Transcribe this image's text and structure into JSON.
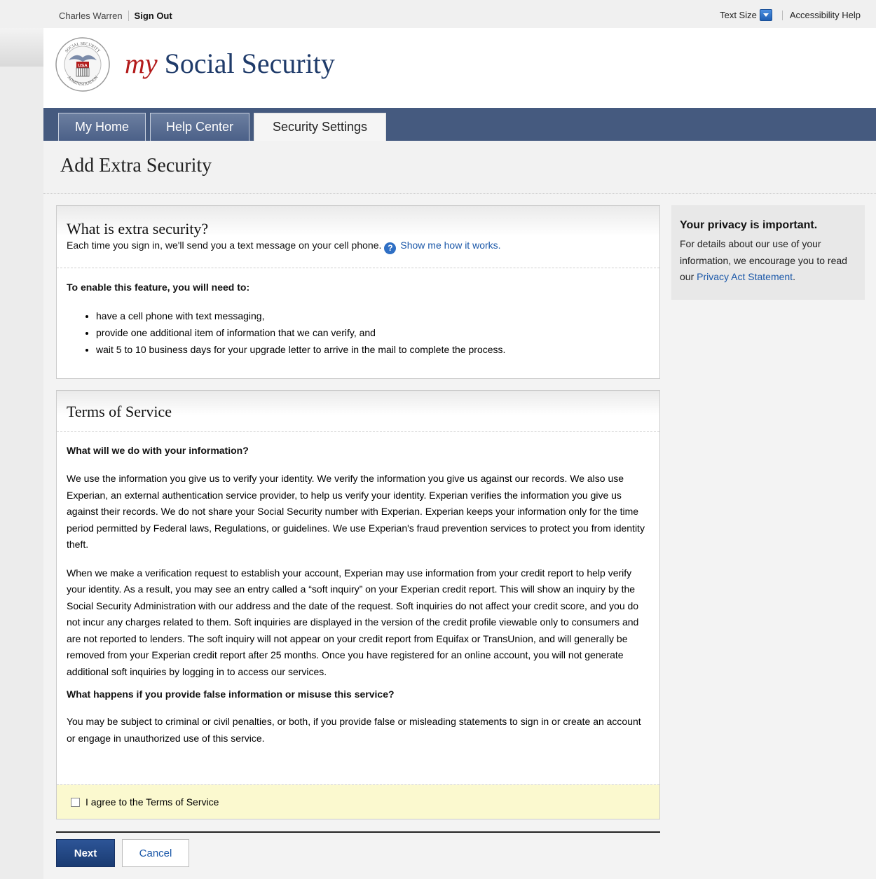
{
  "utility": {
    "user_name": "Charles Warren",
    "sign_out": "Sign Out",
    "text_size": "Text Size",
    "accessibility_help": "Accessibility Help"
  },
  "header": {
    "brand_my": "my",
    "brand_rest": "Social Security",
    "seal_text_top": "SOCIAL SECURITY",
    "seal_text_bottom": "ADMINISTRATION",
    "seal_center": "USA"
  },
  "nav": {
    "tabs": [
      {
        "label": "My Home",
        "active": false
      },
      {
        "label": "Help Center",
        "active": false
      },
      {
        "label": "Security Settings",
        "active": true
      }
    ]
  },
  "page": {
    "title": "Add Extra Security"
  },
  "extra": {
    "heading": "What is extra security?",
    "intro": "Each time you sign in, we'll send you a text message on your cell phone.",
    "help_icon": "?",
    "show_link": "Show me how it works.",
    "enable_heading": "To enable this feature, you will need to:",
    "requirements": [
      "have a cell phone with text messaging,",
      "provide one additional item of information that we can verify, and",
      "wait 5 to 10 business days for your upgrade letter to arrive in the mail to complete the process."
    ]
  },
  "terms": {
    "heading": "Terms of Service",
    "q1": "What will we do with your information?",
    "p1": "We use the information you give us to verify your identity. We verify the information you give us against our records. We also use Experian, an external authentication service provider, to help us verify your identity. Experian verifies the information you give us against their records. We do not share your Social Security number with Experian. Experian keeps your information only for the time period permitted by Federal laws, Regulations, or guidelines. We use Experian's fraud prevention services to protect you from identity theft.",
    "p2": "When we make a verification request to establish your account, Experian may use information from your credit report to help verify your identity. As a result, you may see an entry called a “soft inquiry” on your Experian credit report. This will show an inquiry by the Social Security Administration with our address and the date of the request. Soft inquiries do not affect your credit score, and you do not incur any charges related to them. Soft inquiries are displayed in the version of the credit profile viewable only to consumers and are not reported to lenders. The soft inquiry will not appear on your credit report from Equifax or TransUnion, and will generally be removed from your Experian credit report after 25 months. Once you have registered for an online account, you will not generate additional soft inquiries by logging in to access our services.",
    "q2": "What happens if you provide false information or misuse this service?",
    "p3": "You may be subject to criminal or civil penalties, or both, if you provide false or misleading statements to sign in or create an account or engage in unauthorized use of this service.",
    "agree_label": "I agree to the Terms of Service",
    "agree_checked": false
  },
  "actions": {
    "next": "Next",
    "cancel": "Cancel"
  },
  "sidebar": {
    "title": "Your privacy is important.",
    "body": "For details about our use of your information, we encourage you to read our",
    "link": "Privacy Act Statement",
    "end": "."
  }
}
